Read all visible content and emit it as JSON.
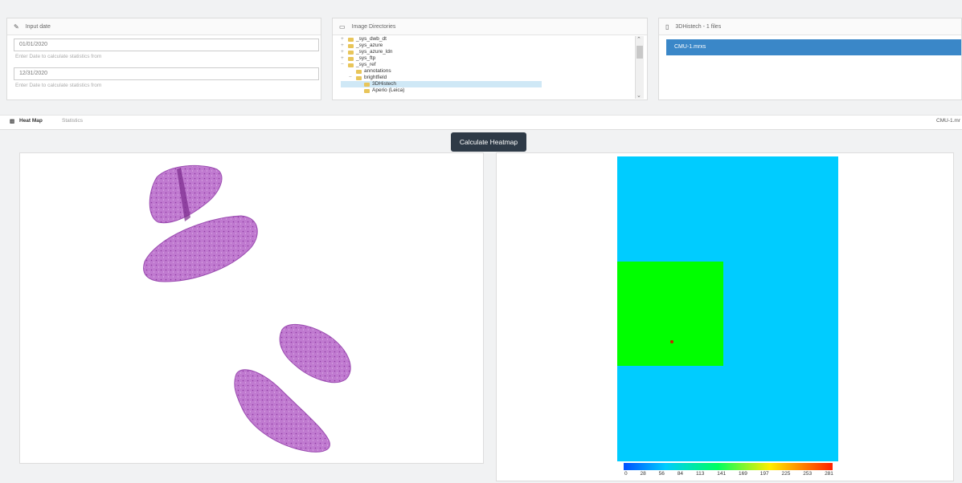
{
  "input_panel": {
    "title": "Input date",
    "date1": "01/01/2020",
    "hint1": "Enter Date to calculate statistics from",
    "date2": "12/31/2020",
    "hint2": "Enter Date to calculate statistics from"
  },
  "dir_panel": {
    "title": "Image Directories",
    "tree": [
      {
        "label": "_sys_dwb_dt",
        "depth": 0,
        "twisty": "+",
        "selected": false
      },
      {
        "label": "_sys_azure",
        "depth": 0,
        "twisty": "+",
        "selected": false
      },
      {
        "label": "_sys_azure_ldn",
        "depth": 0,
        "twisty": "+",
        "selected": false
      },
      {
        "label": "_sys_ftp",
        "depth": 0,
        "twisty": "+",
        "selected": false
      },
      {
        "label": "_sys_ref",
        "depth": 0,
        "twisty": "−",
        "selected": false
      },
      {
        "label": "annotations",
        "depth": 1,
        "twisty": "",
        "selected": false
      },
      {
        "label": "brightfield",
        "depth": 1,
        "twisty": "−",
        "selected": false
      },
      {
        "label": "3DHistech",
        "depth": 2,
        "twisty": "",
        "selected": true
      },
      {
        "label": "Aperio (Leica)",
        "depth": 2,
        "twisty": "",
        "selected": false
      }
    ]
  },
  "selection_panel": {
    "title": "3DHistech - 1 files",
    "selected_file": "CMU-1.mrxs"
  },
  "tabs": {
    "heatmap": "Heat Map",
    "statistics": "Statistics",
    "right_label": "CMU-1.mr"
  },
  "calculate_button": "Calculate Heatmap",
  "colors": {
    "accent": "#3a87c8",
    "button_dark": "#2e3a47",
    "heat_low": "#00cfff",
    "heat_mid": "#00ff00",
    "tissue": "#b45fc0"
  },
  "colorbar_ticks": [
    "0",
    "28",
    "56",
    "84",
    "113",
    "141",
    "169",
    "197",
    "225",
    "253",
    "281"
  ]
}
